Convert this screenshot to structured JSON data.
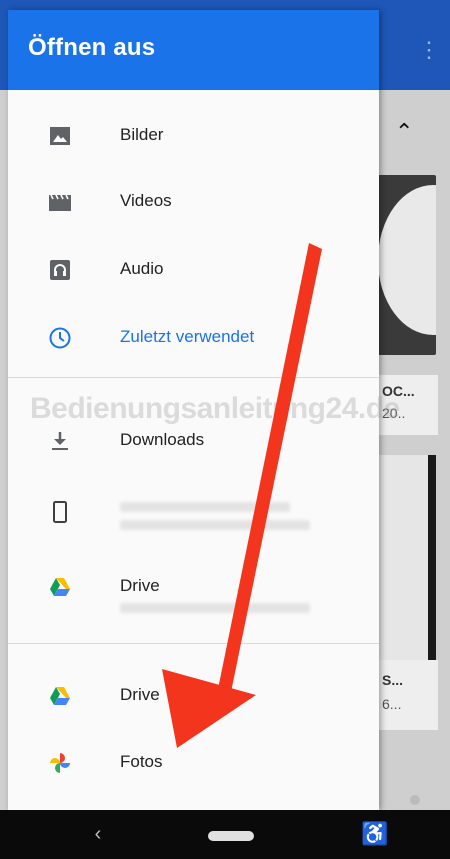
{
  "drawer": {
    "title": "Öffnen aus",
    "items": [
      {
        "label": "Bilder",
        "icon": "image-icon"
      },
      {
        "label": "Videos",
        "icon": "video-icon"
      },
      {
        "label": "Audio",
        "icon": "audio-icon"
      },
      {
        "label": "Zuletzt verwendet",
        "icon": "clock-icon"
      },
      {
        "label": "Downloads",
        "icon": "download-icon"
      },
      {
        "label": "",
        "icon": "phone-icon"
      },
      {
        "label": "Drive",
        "icon": "google-drive-icon"
      },
      {
        "label": "Drive",
        "icon": "google-drive-icon"
      },
      {
        "label": "Fotos",
        "icon": "google-photos-icon"
      }
    ]
  },
  "watermark": "Bedienungsanleitung24.de",
  "background": {
    "card1_text_a": "OC...",
    "card1_text_b": "20..",
    "card2_text_a": "S...",
    "card2_text_b": "6..."
  },
  "colors": {
    "accent": "#1a73e8",
    "arrow": "#f2351c"
  }
}
